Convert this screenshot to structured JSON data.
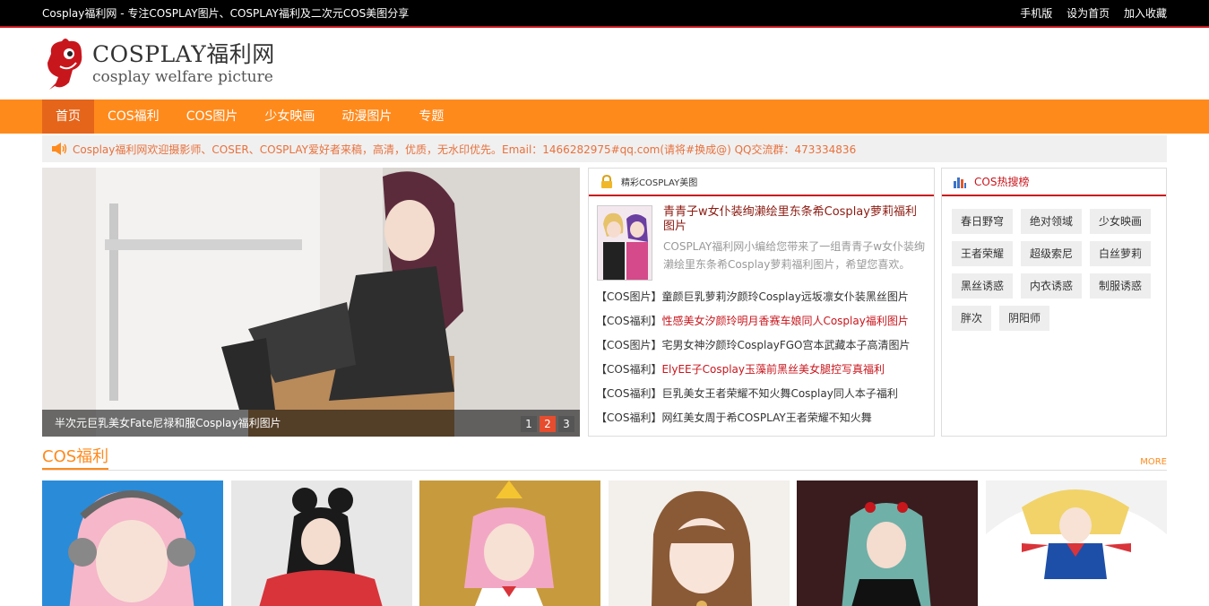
{
  "topbar": {
    "tagline": "Cosplay福利网 - 专注COSPLAY图片、COSPLAY福利及二次元COS美图分享",
    "links": [
      "手机版",
      "设为首页",
      "加入收藏"
    ]
  },
  "logo": {
    "title": "COSPLAY福利网",
    "subtitle": "cosplay welfare picture"
  },
  "nav": {
    "items": [
      "首页",
      "COS福利",
      "COS图片",
      "少女映画",
      "动漫图片",
      "专题"
    ],
    "active_index": 0
  },
  "notice": {
    "text": "Cosplay福利网欢迎摄影师、COSER、COSPLAY爱好者来稿，高清，优质，无水印优先。Email：1466282975#qq.com(请将#换成@) QQ交流群：473334836",
    "icon": "speaker-icon"
  },
  "slider": {
    "caption": "半次元巨乳美女Fate尼禄和服Cosplay福利图片",
    "pages": [
      "1",
      "2",
      "3"
    ],
    "active_page": 1
  },
  "featured": {
    "heading": "精彩COSPLAY美图",
    "title": "青青子w女仆装绚濑绘里东条希Cosplay萝莉福利图片",
    "desc": "COSPLAY福利网小编给您带来了一组青青子w女仆装绚濑绘里东条希Cosplay萝莉福利图片，希望您喜欢。",
    "list": [
      {
        "cat": "【COS图片】",
        "title": "童颜巨乳萝莉汐颜玲Cosplay远坂凛女仆装黑丝图片",
        "red": false
      },
      {
        "cat": "【COS福利】",
        "title": "性感美女汐颜玲明月香赛车娘同人Cosplay福利图片",
        "red": true
      },
      {
        "cat": "【COS图片】",
        "title": "宅男女神汐颜玲CosplayFGO宫本武藏本子高清图片",
        "red": false
      },
      {
        "cat": "【COS福利】",
        "title": "ElyEE子Cosplay玉藻前黑丝美女腿控写真福利",
        "red": true
      },
      {
        "cat": "【COS福利】",
        "title": "巨乳美女王者荣耀不知火舞Cosplay同人本子福利",
        "red": false
      },
      {
        "cat": "【COS福利】",
        "title": "网红美女周于希COSPLAY王者荣耀不知火舞",
        "red": false
      }
    ]
  },
  "hot": {
    "heading": "COS热搜榜",
    "tags": [
      "春日野穹",
      "绝对领域",
      "少女映画",
      "王者荣耀",
      "超级索尼",
      "白丝萝莉",
      "黑丝诱惑",
      "内衣诱惑",
      "制服诱惑",
      "胖次",
      "阴阳师"
    ]
  },
  "section": {
    "title": "COS福利",
    "more": "MORE"
  },
  "colors": {
    "brand_orange": "#ff8a1c",
    "accent_red": "#c8161d",
    "notice_text": "#e8713c"
  }
}
